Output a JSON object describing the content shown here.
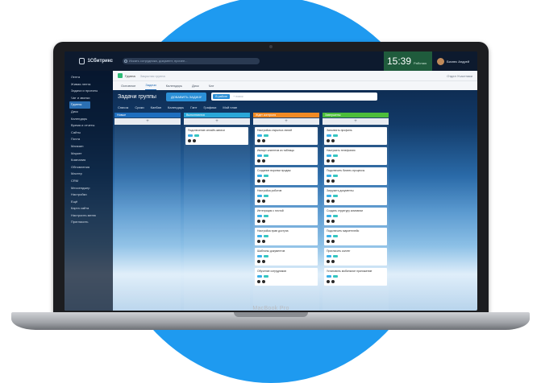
{
  "device": {
    "brand": "MacBook Pro"
  },
  "app": {
    "logo": "1Сбитрикс",
    "search_placeholder": "Искать сотрудника, документ, прочее...",
    "clock": {
      "time": "15:39",
      "status": "Работаю"
    },
    "user": {
      "name": "Бизнес Андрей"
    }
  },
  "sidebar": {
    "items": [
      {
        "label": "Лента"
      },
      {
        "label": "Живая лента"
      },
      {
        "label": "Задачи и проекты"
      },
      {
        "label": "Чат и звонки"
      },
      {
        "label": "Группы",
        "active": true
      },
      {
        "label": "Диск"
      },
      {
        "label": "Календарь"
      },
      {
        "label": "Время и отчеты"
      },
      {
        "label": "Сайты"
      },
      {
        "label": "Почта"
      },
      {
        "label": "Магазин"
      },
      {
        "label": "Маркет"
      },
      {
        "label": "Компания"
      },
      {
        "label": "Обновления"
      },
      {
        "label": "Мастер"
      },
      {
        "label": "CRM"
      },
      {
        "label": "Мессенджер"
      },
      {
        "label": "Настройки"
      },
      {
        "label": "Ещё"
      },
      {
        "label": "Карта сайта"
      },
      {
        "label": "Настроить меню"
      },
      {
        "label": "Пригласить"
      }
    ]
  },
  "group": {
    "name": "Группа",
    "subtitle": "Закрытая группа",
    "right_links": "Отдел   Участники"
  },
  "tabs": [
    {
      "label": "Основное"
    },
    {
      "label": "Задачи",
      "active": true
    },
    {
      "label": "Календарь"
    },
    {
      "label": "Диск"
    },
    {
      "label": "Чат"
    }
  ],
  "toolbar": {
    "title": "Задачи группы",
    "add_button": "ДОБАВИТЬ ЗАДАЧУ",
    "filter_chip": "В работе",
    "filter_placeholder": "+ поиск"
  },
  "subtabs": [
    {
      "label": "Список"
    },
    {
      "label": "Сроки"
    },
    {
      "label": "Канбан"
    },
    {
      "label": "Календарь"
    },
    {
      "label": "Гант"
    },
    {
      "label": "Графики"
    },
    {
      "label": "Мой план"
    }
  ],
  "columns": [
    {
      "title": "Новые",
      "color": "#1e6fbf",
      "cards": []
    },
    {
      "title": "Выполняются",
      "color": "#2aa7d8",
      "cards": [
        {
          "title": "Подключение онлайн-записи"
        }
      ]
    },
    {
      "title": "Ждет контроля",
      "color": "#f08a24",
      "cards": [
        {
          "title": "Настройка открытых линий"
        },
        {
          "title": "Импорт клиентов из таблицы"
        },
        {
          "title": "Создание воронки продаж"
        },
        {
          "title": "Настройка роботов"
        },
        {
          "title": "Интеграция с почтой"
        },
        {
          "title": "Настройка прав доступа"
        },
        {
          "title": "Шаблоны документов"
        },
        {
          "title": "Обучение сотрудников"
        }
      ]
    },
    {
      "title": "Завершены",
      "color": "#4cbd3a",
      "cards": [
        {
          "title": "Заполнить профиль"
        },
        {
          "title": "Настроить телефонию"
        },
        {
          "title": "Подключить бизнес-процессы"
        },
        {
          "title": "Загрузить документы"
        },
        {
          "title": "Создать структуру компании"
        },
        {
          "title": "Подключить маркетплейс"
        },
        {
          "title": "Пригласить коллег"
        },
        {
          "title": "Установить мобильное приложение"
        }
      ]
    }
  ]
}
